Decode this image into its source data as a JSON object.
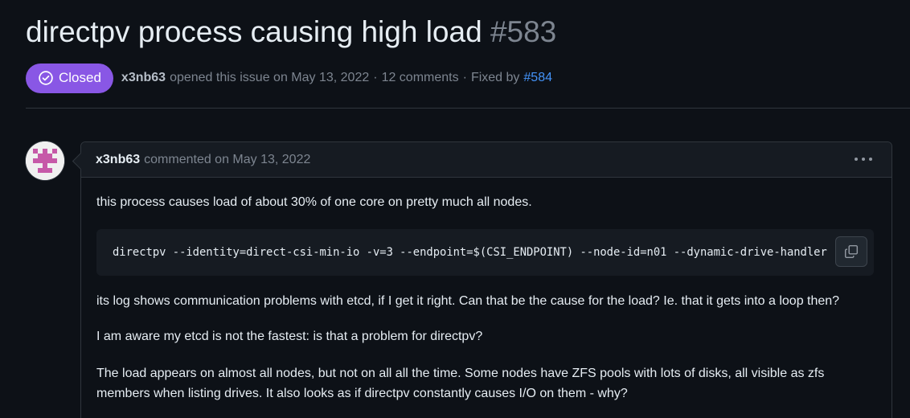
{
  "issue": {
    "title": "directpv process causing high load",
    "number": "#583",
    "status": "Closed",
    "author": "x3nb63",
    "opened_text": "opened this issue on May 13, 2022",
    "comments_text": "12 comments",
    "fixed_by_text": "Fixed by",
    "fixed_by_link": "#584",
    "separator": "·"
  },
  "comment": {
    "author": "x3nb63",
    "meta": "commented on May 13, 2022",
    "paragraph1": "this process causes load of about 30% of one core on pretty much all nodes.",
    "code": "directpv --identity=direct-csi-min-io -v=3 --endpoint=$(CSI_ENDPOINT) --node-id=n01 --dynamic-drive-handler",
    "paragraph2": "its log shows communication problems with etcd, if I get it right. Can that be the cause for the load? Ie. that it gets into a loop then?",
    "paragraph3": "I am aware my etcd is not the fastest: is that a problem for directpv?",
    "paragraph4": "The load appears on almost all nodes, but not on all all the time. Some nodes have ZFS pools with lots of disks, all visible as zfs members when listing drives. It also looks as if directpv constantly causes I/O on them - why?"
  },
  "colors": {
    "background": "#0d1117",
    "closed_badge": "#8957e5",
    "link": "#4493f8",
    "avatar_identicon": "#c659a8"
  },
  "icons": {
    "status": "check-circle-icon",
    "menu": "kebab-horizontal-icon",
    "copy": "copy-icon"
  }
}
